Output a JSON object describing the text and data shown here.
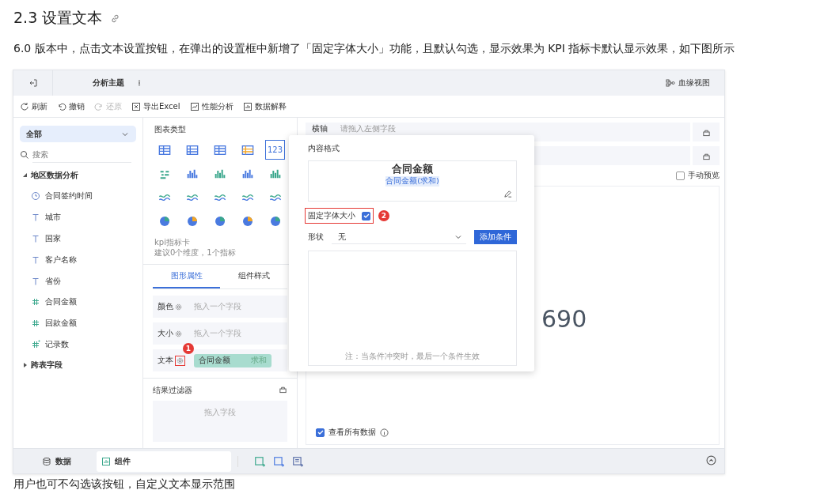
{
  "heading": {
    "title": "2.3 设置文本"
  },
  "intro": "6.0 版本中，点击文本设置按钮，在弹出的设置框中新增了「固定字体大小」功能，且默认勾选，显示效果为 KPI 指标卡默认显示效果，如下图所示",
  "app": {
    "topbar": {
      "title": "分析主题",
      "lineage": "血缘视图"
    },
    "toolbar": [
      {
        "label": "刷新",
        "kind": "refresh",
        "disabled": false
      },
      {
        "label": "撤销",
        "kind": "undo",
        "disabled": false
      },
      {
        "label": "还原",
        "kind": "redo",
        "disabled": true
      },
      {
        "label": "导出Excel",
        "kind": "excel",
        "disabled": false
      },
      {
        "label": "性能分析",
        "kind": "perf",
        "disabled": false
      },
      {
        "label": "数据解释",
        "kind": "explain",
        "disabled": false
      }
    ],
    "data_panel": {
      "scope": "全部",
      "search_placeholder": "搜索",
      "tree": [
        {
          "label": "地区数据分析",
          "expanded": true,
          "children": [
            {
              "label": "合同签约时间",
              "kind": "date"
            },
            {
              "label": "城市",
              "kind": "text"
            },
            {
              "label": "国家",
              "kind": "text"
            },
            {
              "label": "客户名称",
              "kind": "text"
            },
            {
              "label": "省份",
              "kind": "text"
            },
            {
              "label": "合同金额",
              "kind": "measure"
            },
            {
              "label": "回款金额",
              "kind": "measure"
            },
            {
              "label": "记录数",
              "kind": "computed"
            }
          ]
        },
        {
          "label": "跨表字段",
          "expanded": false
        }
      ]
    },
    "chart_panel": {
      "title": "图表类型",
      "chart_types": [
        {
          "selected": false
        },
        {
          "selected": false
        },
        {
          "selected": false
        },
        {
          "selected": false
        },
        {
          "label": "123",
          "selected": true
        },
        {
          "selected": false
        },
        {
          "selected": false
        },
        {
          "selected": false
        },
        {
          "selected": false
        },
        {
          "selected": false
        },
        {
          "selected": false
        },
        {
          "selected": false
        },
        {
          "selected": false
        },
        {
          "selected": false
        },
        {
          "selected": false
        },
        {
          "selected": false
        },
        {
          "selected": false
        },
        {
          "selected": false
        },
        {
          "selected": false
        },
        {
          "selected": false
        }
      ],
      "chart_name": "kpi指标卡",
      "chart_hint": "建议0个维度，1个指标",
      "tabs": [
        {
          "label": "图形属性",
          "selected": true
        },
        {
          "label": "组件样式",
          "selected": false
        }
      ],
      "properties": [
        {
          "label": "颜色",
          "placeholder": "拖入一个字段"
        },
        {
          "label": "大小",
          "placeholder": "拖入一个字段"
        },
        {
          "label": "文本",
          "field": "合同金额",
          "aggregation": "求和",
          "marker": "1"
        }
      ],
      "filter": {
        "title": "结果过滤器",
        "placeholder": "拖入字段"
      }
    },
    "axis_row": {
      "label": "横轴",
      "placeholder": "请拖入左侧字段"
    },
    "manual_preview": {
      "label": "手动预览",
      "checked": false
    },
    "kpi_value": "690",
    "view_all": {
      "label": "查看所有数据",
      "checked": true
    },
    "popup": {
      "title": "内容格式",
      "content_title": "合同金额",
      "content_field": "合同金额(求和)",
      "fixed_font": {
        "label": "固定字体大小",
        "checked": true,
        "marker": "2"
      },
      "shape_label": "形状",
      "shape_value": "无",
      "add_button": "添加条件",
      "note": "注：当条件冲突时，最后一个条件生效"
    },
    "bottom_tabs": [
      {
        "label": "数据",
        "selected": false
      },
      {
        "label": "组件",
        "selected": true
      }
    ]
  },
  "footer_text": "用户也可不勾选该按钮，自定义文本显示范围"
}
